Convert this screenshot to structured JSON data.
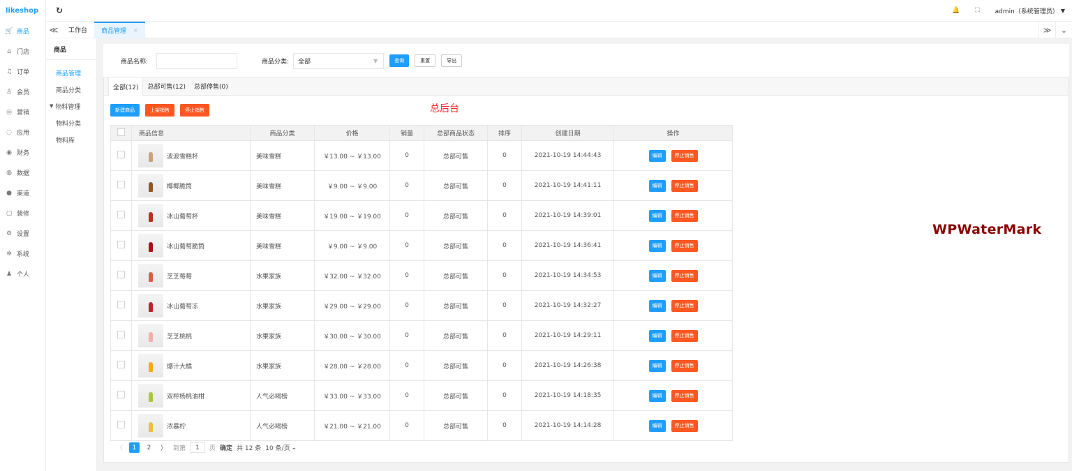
{
  "app": {
    "logo": "likeshop"
  },
  "sidebar": {
    "items": [
      {
        "icon": "cart-icon",
        "glyph": "🛒",
        "label": "商品",
        "active": true
      },
      {
        "icon": "store-icon",
        "glyph": "⌂",
        "label": "门店"
      },
      {
        "icon": "bell-icon",
        "glyph": "♫",
        "label": "订单"
      },
      {
        "icon": "user-icon",
        "glyph": "♙",
        "label": "会员"
      },
      {
        "icon": "marketing-icon",
        "glyph": "◎",
        "label": "营销"
      },
      {
        "icon": "apps-icon",
        "glyph": "◌",
        "label": "应用"
      },
      {
        "icon": "finance-icon",
        "glyph": "◉",
        "label": "财务"
      },
      {
        "icon": "data-icon",
        "glyph": "◍",
        "label": "数据"
      },
      {
        "icon": "channel-icon",
        "glyph": "●",
        "label": "渠道"
      },
      {
        "icon": "decor-icon",
        "glyph": "▢",
        "label": "装修"
      },
      {
        "icon": "settings-icon",
        "glyph": "⚙",
        "label": "设置"
      },
      {
        "icon": "system-icon",
        "glyph": "✲",
        "label": "系统"
      },
      {
        "icon": "person-icon",
        "glyph": "♟",
        "label": "个人"
      }
    ]
  },
  "header": {
    "refresh_icon": "refresh-icon",
    "user": "admin（系统管理员）",
    "user_caret": "▼",
    "bell_glyph": "🔔",
    "fullscreen_glyph": "⛶"
  },
  "page_tabs": {
    "left_arrow": "≪",
    "items": [
      {
        "label": "工作台",
        "active": false
      },
      {
        "label": "商品管理",
        "active": true,
        "close": "×"
      }
    ],
    "right_arrow": "≫",
    "dropdown": "⌄"
  },
  "submenu": {
    "title": "商品",
    "items": [
      {
        "label": "商品管理",
        "active": true
      },
      {
        "label": "商品分类"
      },
      {
        "label": "物料管理",
        "group": true
      },
      {
        "label": "物料分类"
      },
      {
        "label": "物料库"
      }
    ]
  },
  "filter": {
    "name_label": "商品名称:",
    "name_value": "",
    "category_label": "商品分类:",
    "category_value": "全部",
    "search": "查询",
    "reset": "重置",
    "export": "导出"
  },
  "status_tabs": [
    {
      "label": "全部(12)",
      "active": true
    },
    {
      "label": "总部可售(12)"
    },
    {
      "label": "总部停售(0)"
    }
  ],
  "actions": {
    "create": "新建商品",
    "on_sale": "上架销售",
    "stop": "停止销售"
  },
  "banner": "总后台",
  "table": {
    "headers": [
      "商品信息",
      "商品分类",
      "价格",
      "销量",
      "总部商品状态",
      "排序",
      "创建日期",
      "操作"
    ],
    "rows": [
      {
        "name": "波波雪糕杯",
        "category": "美味雪糕",
        "price": "￥13.00 ~ ￥13.00",
        "sales": "0",
        "status": "总部可售",
        "sort": "0",
        "date": "2021-10-19 14:44:43",
        "thumb_color": "#c9a27a"
      },
      {
        "name": "椰椰脆筒",
        "category": "美味雪糕",
        "price": "￥9.00 ~ ￥9.00",
        "sales": "0",
        "status": "总部可售",
        "sort": "0",
        "date": "2021-10-19 14:41:11",
        "thumb_color": "#8b5a2b"
      },
      {
        "name": "冰山葡萄杯",
        "category": "美味雪糕",
        "price": "￥19.00 ~ ￥19.00",
        "sales": "0",
        "status": "总部可售",
        "sort": "0",
        "date": "2021-10-19 14:39:01",
        "thumb_color": "#b2331f"
      },
      {
        "name": "冰山葡萄脆筒",
        "category": "美味雪糕",
        "price": "￥9.00 ~ ￥9.00",
        "sales": "0",
        "status": "总部可售",
        "sort": "0",
        "date": "2021-10-19 14:36:41",
        "thumb_color": "#a31515"
      },
      {
        "name": "芝芝莓莓",
        "category": "水果家族",
        "price": "￥32.00 ~ ￥32.00",
        "sales": "0",
        "status": "总部可售",
        "sort": "0",
        "date": "2021-10-19 14:34:53",
        "thumb_color": "#e05a4a"
      },
      {
        "name": "冰山葡萄冻",
        "category": "水果家族",
        "price": "￥29.00 ~ ￥29.00",
        "sales": "0",
        "status": "总部可售",
        "sort": "0",
        "date": "2021-10-19 14:32:27",
        "thumb_color": "#c0202a"
      },
      {
        "name": "芝芝桃桃",
        "category": "水果家族",
        "price": "￥30.00 ~ ￥30.00",
        "sales": "0",
        "status": "总部可售",
        "sort": "0",
        "date": "2021-10-19 14:29:11",
        "thumb_color": "#f0b0a8"
      },
      {
        "name": "爆汁大橘",
        "category": "水果家族",
        "price": "￥28.00 ~ ￥28.00",
        "sales": "0",
        "status": "总部可售",
        "sort": "0",
        "date": "2021-10-19 14:26:38",
        "thumb_color": "#f5a623"
      },
      {
        "name": "双榨杨桃油柑",
        "category": "人气必喝榜",
        "price": "￥33.00 ~ ￥33.00",
        "sales": "0",
        "status": "总部可售",
        "sort": "0",
        "date": "2021-10-19 14:18:35",
        "thumb_color": "#a7c83a"
      },
      {
        "name": "浓暴柠",
        "category": "人气必喝榜",
        "price": "￥21.00 ~ ￥21.00",
        "sales": "0",
        "status": "总部可售",
        "sort": "0",
        "date": "2021-10-19 14:14:28",
        "thumb_color": "#e8c13a"
      }
    ],
    "edit_label": "编辑",
    "stop_label": "停止销售"
  },
  "pagination": {
    "prev": "〈",
    "pages": [
      "1",
      "2"
    ],
    "current": "1",
    "next": "〉",
    "goto_label": "到第",
    "goto_value": "1",
    "page_unit": "页",
    "confirm": "确定",
    "total": "共 12 条",
    "per_page": "10 条/页",
    "per_page_caret": "⌄"
  },
  "watermark": "WPWaterMark",
  "colors": {
    "primary": "#1e9fff",
    "danger": "#ff5722",
    "banner": "#ff2a2a",
    "watermark": "#8b0000"
  }
}
